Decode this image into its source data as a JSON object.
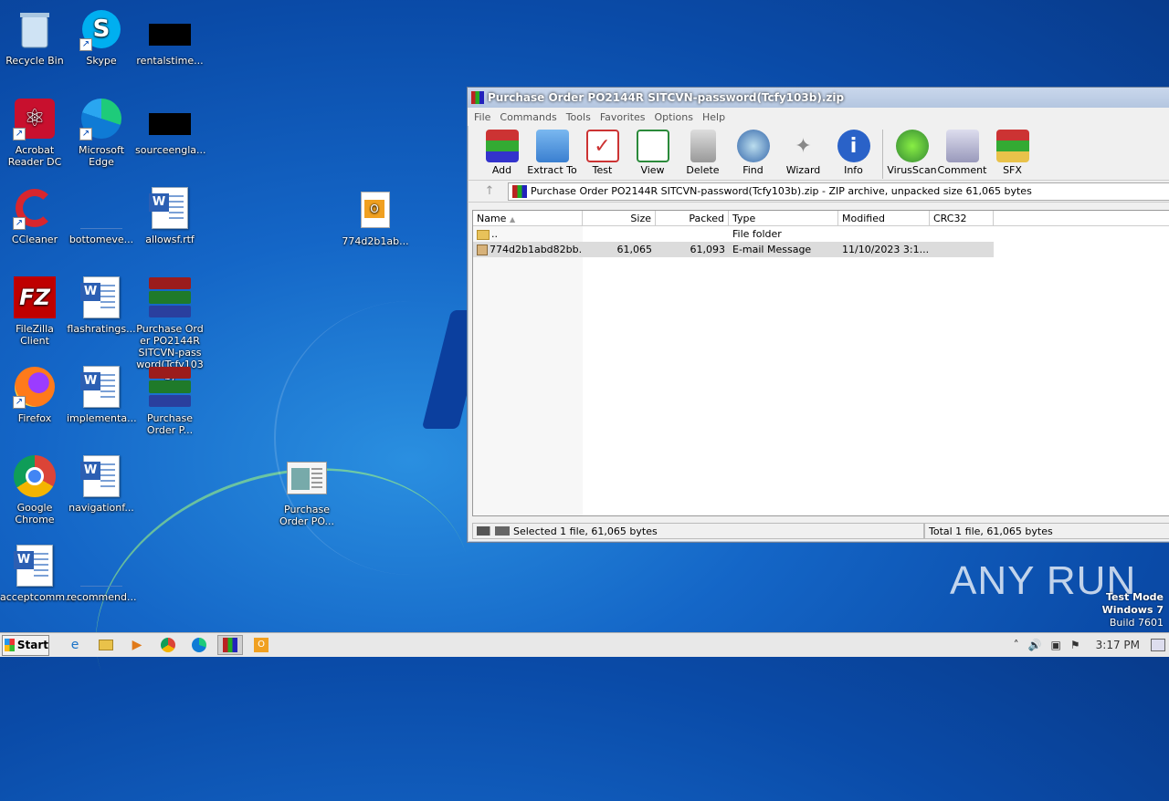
{
  "desktop": {
    "icons": {
      "recycle_bin": "Recycle Bin",
      "skype": "Skype",
      "rentalstime": "rentalstime...",
      "acrobat": "Acrobat Reader DC",
      "edge": "Microsoft Edge",
      "sourceengla": "sourceengla...",
      "ccleaner": "CCleaner",
      "bottomeve": "bottomeve...",
      "allowsf": "allowsf.rtf",
      "msg774": "774d2b1ab...",
      "filezilla": "FileZilla Client",
      "flashratings": "flashratings...",
      "purchase_zip": "Purchase Order PO2144R SITCVN-password(Tcfy103b)",
      "firefox": "Firefox",
      "implementa": "implementa...",
      "purchase_p": "Purchase Order P...",
      "chrome": "Google Chrome",
      "navigationf": "navigationf...",
      "purchase_po": "Purchase Order PO...",
      "acceptcomm": "acceptcomm...",
      "recommend": "recommend..."
    }
  },
  "window": {
    "title": "Purchase Order PO2144R SITCVN-password(Tcfy103b).zip",
    "menu": [
      "File",
      "Commands",
      "Tools",
      "Favorites",
      "Options",
      "Help"
    ],
    "toolbar": [
      {
        "label": "Add",
        "icon": "add-archive-icon"
      },
      {
        "label": "Extract To",
        "icon": "extract-folder-icon"
      },
      {
        "label": "Test",
        "icon": "test-clipboard-icon"
      },
      {
        "label": "View",
        "icon": "view-book-icon"
      },
      {
        "label": "Delete",
        "icon": "trash-icon"
      },
      {
        "label": "Find",
        "icon": "magnifier-icon"
      },
      {
        "label": "Wizard",
        "icon": "wand-icon"
      },
      {
        "label": "Info",
        "icon": "info-icon"
      },
      {
        "label": "VirusScan",
        "icon": "bug-icon"
      },
      {
        "label": "Comment",
        "icon": "comment-icon"
      },
      {
        "label": "SFX",
        "icon": "sfx-box-icon"
      }
    ],
    "address": "Purchase Order PO2144R SITCVN-password(Tcfy103b).zip - ZIP archive, unpacked size 61,065 bytes",
    "columns": [
      "Name",
      "Size",
      "Packed",
      "Type",
      "Modified",
      "CRC32"
    ],
    "rows": [
      {
        "name": "..",
        "size": "",
        "packed": "",
        "type": "File folder",
        "modified": "",
        "crc": ""
      },
      {
        "name": "774d2b1abd82bb...",
        "size": "61,065",
        "packed": "61,093",
        "type": "E-mail Message",
        "modified": "11/10/2023 3:1...",
        "crc": ""
      }
    ],
    "status_left": "Selected 1 file, 61,065 bytes",
    "status_right": "Total 1 file, 61,065 bytes"
  },
  "taskbar": {
    "start": "Start",
    "clock": "3:17 PM"
  },
  "watermark": "ANY RUN",
  "test_mode": {
    "line1": "Test Mode",
    "line2": "Windows 7",
    "line3": "Build 7601"
  }
}
